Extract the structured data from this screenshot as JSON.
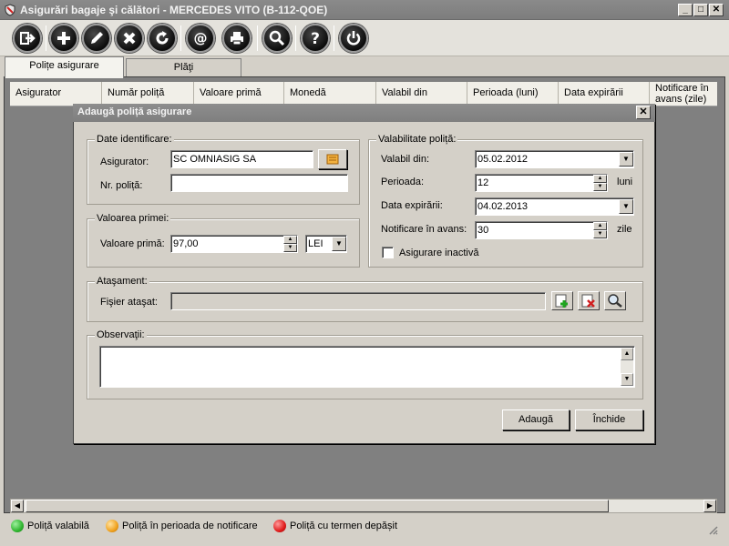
{
  "window": {
    "title": "Asigurări bagaje şi călători - MERCEDES VITO (B-112-QOE)"
  },
  "tabs": [
    {
      "label": "Polițe asigurare"
    },
    {
      "label": "Plăţi"
    }
  ],
  "grid": {
    "columns": [
      "Asigurator",
      "Număr poliță",
      "Valoare primă",
      "Monedă",
      "Valabil din",
      "Perioada (luni)",
      "Data expirării",
      "Notificare în avans (zile)"
    ]
  },
  "legend": [
    {
      "label": "Poliță valabilă",
      "color": "#2fb52f"
    },
    {
      "label": "Poliță în perioada de notificare",
      "color": "#f0a21e"
    },
    {
      "label": "Poliță cu termen depășit",
      "color": "#e01b1b"
    }
  ],
  "dialog": {
    "title": "Adaugă poliță asigurare",
    "identificare": {
      "group_label": "Date identificare:",
      "asigurator_label": "Asigurator:",
      "asigurator_value": "SC OMNIASIG SA",
      "nr_label": "Nr. poliță:",
      "nr_value": ""
    },
    "prima": {
      "group_label": "Valoarea primei:",
      "label": "Valoare primă:",
      "value": "97,00",
      "currency": "LEI"
    },
    "valabilitate": {
      "group_label": "Valabilitate poliță:",
      "din_label": "Valabil din:",
      "din_value": "05.02.2012",
      "perioada_label": "Perioada:",
      "perioada_value": "12",
      "perioada_unit": "luni",
      "expirare_label": "Data expirării:",
      "expirare_value": "04.02.2013",
      "notificare_label": "Notificare în avans:",
      "notificare_value": "30",
      "notificare_unit": "zile",
      "inactiva_label": "Asigurare inactivă",
      "inactiva_checked": false
    },
    "atasament": {
      "group_label": "Ataşament:",
      "fisier_label": "Fişier ataşat:",
      "fisier_value": ""
    },
    "observatii": {
      "group_label": "Observaţii:",
      "value": ""
    },
    "buttons": {
      "add": "Adaugă",
      "close": "Închide"
    }
  }
}
